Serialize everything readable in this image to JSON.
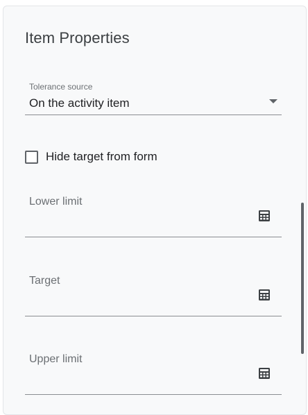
{
  "panel": {
    "title": "Item Properties"
  },
  "tolerance_source": {
    "label": "Tolerance source",
    "value": "On the activity item"
  },
  "hide_target": {
    "label": "Hide target from form",
    "checked": false
  },
  "fields": [
    {
      "label": "Lower limit",
      "icon": "calculator-icon"
    },
    {
      "label": "Target",
      "icon": "calculator-icon"
    },
    {
      "label": "Upper limit",
      "icon": "calculator-icon"
    }
  ]
}
